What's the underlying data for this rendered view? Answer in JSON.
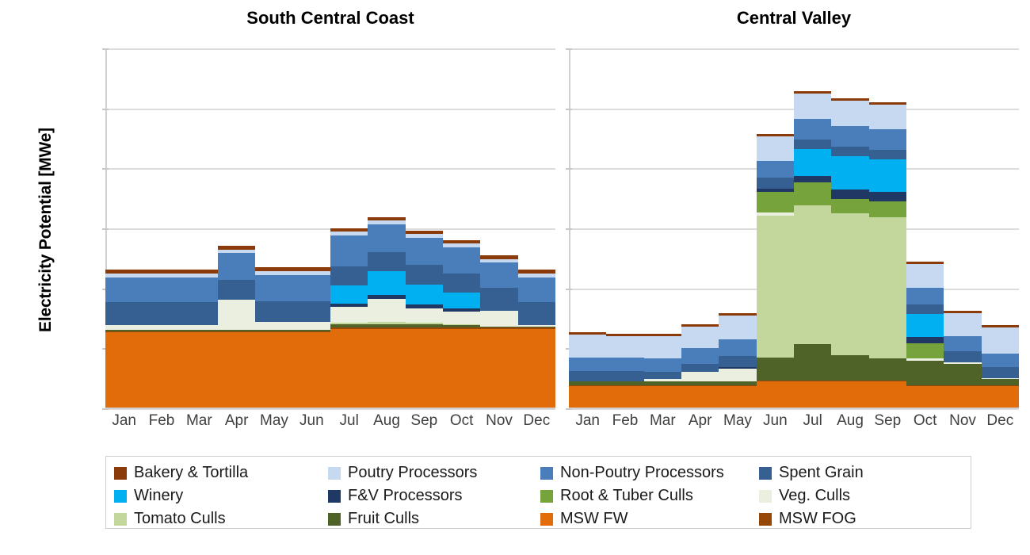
{
  "axis": {
    "ylabel": "Electricity Potential [MWe]",
    "yticks": [
      "0",
      "50",
      "100",
      "150",
      "200",
      "250",
      "300"
    ],
    "ymin": 0,
    "ymax": 300,
    "xticks": [
      "Jan",
      "Feb",
      "Mar",
      "Apr",
      "May",
      "Jun",
      "Jul",
      "Aug",
      "Sep",
      "Oct",
      "Nov",
      "Dec"
    ]
  },
  "legend": {
    "items": [
      {
        "label": "Bakery & Tortilla",
        "color": "#8B3A0A"
      },
      {
        "label": "Poutry Processors",
        "color": "#C6D9F0"
      },
      {
        "label": "Non-Poutry Processors",
        "color": "#4A7EBB"
      },
      {
        "label": "Spent Grain",
        "color": "#376092"
      },
      {
        "label": "Winery",
        "color": "#00B0F0"
      },
      {
        "label": "F&V Processors",
        "color": "#1F3864"
      },
      {
        "label": "Root & Tuber Culls",
        "color": "#77A33C"
      },
      {
        "label": "Veg. Culls",
        "color": "#EAEFE0"
      },
      {
        "label": "Tomato Culls",
        "color": "#C3D69B"
      },
      {
        "label": "Fruit Culls",
        "color": "#4F6228"
      },
      {
        "label": "MSW FW",
        "color": "#E36C0A"
      },
      {
        "label": "MSW FOG",
        "color": "#974806"
      }
    ]
  },
  "chart_data": {
    "type": "bar",
    "subtype": "stacked",
    "title": "",
    "xlabel": "",
    "ylabel": "Electricity Potential [MWe]",
    "ylim": [
      0,
      300
    ],
    "grid": true,
    "legend_position": "bottom",
    "categories": [
      "Jan",
      "Feb",
      "Mar",
      "Apr",
      "May",
      "Jun",
      "Jul",
      "Aug",
      "Sep",
      "Oct",
      "Nov",
      "Dec"
    ],
    "series_order": [
      "MSW FW",
      "MSW FOG",
      "Fruit Culls",
      "Tomato Culls",
      "Veg. Culls",
      "Root & Tuber Culls",
      "F&V Processors",
      "Winery",
      "Spent Grain",
      "Non-Poutry Processors",
      "Poutry Processors",
      "Bakery & Tortilla"
    ],
    "panels": [
      {
        "name": "South Central Coast",
        "series": [
          {
            "name": "MSW FW",
            "color": "#E36C0A",
            "values": [
              64,
              64,
              64,
              64,
              64,
              64,
              67,
              67,
              67,
              67,
              67,
              67
            ]
          },
          {
            "name": "MSW FOG",
            "color": "#974806",
            "values": [
              1,
              1,
              1,
              1,
              1,
              1,
              1,
              1,
              1,
              1,
              1,
              1
            ]
          },
          {
            "name": "Fruit Culls",
            "color": "#4F6228",
            "values": [
              1,
              1,
              1,
              1,
              1,
              1,
              3,
              3,
              3,
              2,
              1,
              1
            ]
          },
          {
            "name": "Tomato Culls",
            "color": "#C3D69B",
            "values": [
              0,
              0,
              0,
              0,
              0,
              0,
              1,
              2,
              1,
              1,
              0,
              0
            ]
          },
          {
            "name": "Veg. Culls",
            "color": "#EAEFE0",
            "values": [
              4,
              4,
              4,
              25,
              7,
              7,
              13,
              19,
              12,
              10,
              13,
              1
            ]
          },
          {
            "name": "Root & Tuber Culls",
            "color": "#77A33C",
            "values": [
              0,
              0,
              0,
              0,
              0,
              0,
              0,
              0,
              0,
              0,
              0,
              0
            ]
          },
          {
            "name": "F&V Processors",
            "color": "#1F3864",
            "values": [
              0,
              0,
              0,
              0,
              0,
              0,
              3,
              3,
              3,
              3,
              0,
              0
            ]
          },
          {
            "name": "Winery",
            "color": "#00B0F0",
            "values": [
              0,
              0,
              0,
              0,
              0,
              0,
              15,
              20,
              17,
              13,
              0,
              0
            ]
          },
          {
            "name": "Spent Grain",
            "color": "#376092",
            "values": [
              19,
              19,
              19,
              17,
              17,
              17,
              16,
              16,
              16,
              16,
              19,
              19
            ]
          },
          {
            "name": "Non-Poutry Processors",
            "color": "#4A7EBB",
            "values": [
              21,
              21,
              21,
              22,
              22,
              22,
              26,
              23,
              23,
              22,
              21,
              21
            ]
          },
          {
            "name": "Poutry Processors",
            "color": "#C6D9F0",
            "values": [
              3,
              3,
              3,
              3,
              3,
              3,
              3,
              3,
              3,
              3,
              3,
              3
            ]
          },
          {
            "name": "Bakery & Tortilla",
            "color": "#8B3A0A",
            "values": [
              3,
              3,
              3,
              3,
              3,
              3,
              3,
              3,
              3,
              3,
              3,
              3
            ]
          }
        ],
        "totals": [
          116,
          116,
          116,
          136,
          118,
          118,
          152,
          159,
          149,
          147,
          128,
          116
        ]
      },
      {
        "name": "Central Valley",
        "series": [
          {
            "name": "MSW FW",
            "color": "#E36C0A",
            "values": [
              19,
              19,
              19,
              19,
              19,
              23,
              23,
              23,
              23,
              19,
              19,
              19
            ]
          },
          {
            "name": "MSW FOG",
            "color": "#974806",
            "values": [
              1,
              1,
              1,
              1,
              1,
              1,
              1,
              1,
              1,
              1,
              1,
              1
            ]
          },
          {
            "name": "Fruit Culls",
            "color": "#4F6228",
            "values": [
              3,
              3,
              3,
              3,
              3,
              19,
              30,
              21,
              18,
              20,
              18,
              5
            ]
          },
          {
            "name": "Tomato Culls",
            "color": "#C3D69B",
            "values": [
              0,
              0,
              0,
              0,
              0,
              118,
              116,
              118,
              118,
              0,
              0,
              0
            ]
          },
          {
            "name": "Veg. Culls",
            "color": "#EAEFE0",
            "values": [
              0,
              0,
              2,
              8,
              11,
              3,
              0,
              0,
              0,
              2,
              1,
              1
            ]
          },
          {
            "name": "Root & Tuber Culls",
            "color": "#77A33C",
            "values": [
              0,
              0,
              0,
              0,
              0,
              17,
              19,
              12,
              13,
              13,
              0,
              0
            ]
          },
          {
            "name": "F&V Processors",
            "color": "#1F3864",
            "values": [
              0,
              0,
              0,
              0,
              1,
              3,
              5,
              8,
              8,
              5,
              0,
              0
            ]
          },
          {
            "name": "Winery",
            "color": "#00B0F0",
            "values": [
              0,
              0,
              0,
              0,
              0,
              0,
              23,
              28,
              27,
              19,
              0,
              0
            ]
          },
          {
            "name": "Spent Grain",
            "color": "#376092",
            "values": [
              9,
              9,
              6,
              7,
              9,
              9,
              8,
              8,
              8,
              8,
              9,
              9
            ]
          },
          {
            "name": "Non-Poutry Processors",
            "color": "#4A7EBB",
            "values": [
              11,
              11,
              11,
              13,
              14,
              14,
              17,
              17,
              17,
              14,
              13,
              11
            ]
          },
          {
            "name": "Poutry Processors",
            "color": "#C6D9F0",
            "values": [
              19,
              18,
              19,
              18,
              20,
              20,
              21,
              21,
              21,
              20,
              19,
              22
            ]
          },
          {
            "name": "Bakery & Tortilla",
            "color": "#8B3A0A",
            "values": [
              2,
              2,
              2,
              2,
              2,
              2,
              2,
              2,
              2,
              2,
              2,
              2
            ]
          }
        ],
        "totals": [
          64,
          63,
          63,
          71,
          80,
          229,
          265,
          259,
          256,
          133,
          82,
          70
        ]
      }
    ]
  }
}
